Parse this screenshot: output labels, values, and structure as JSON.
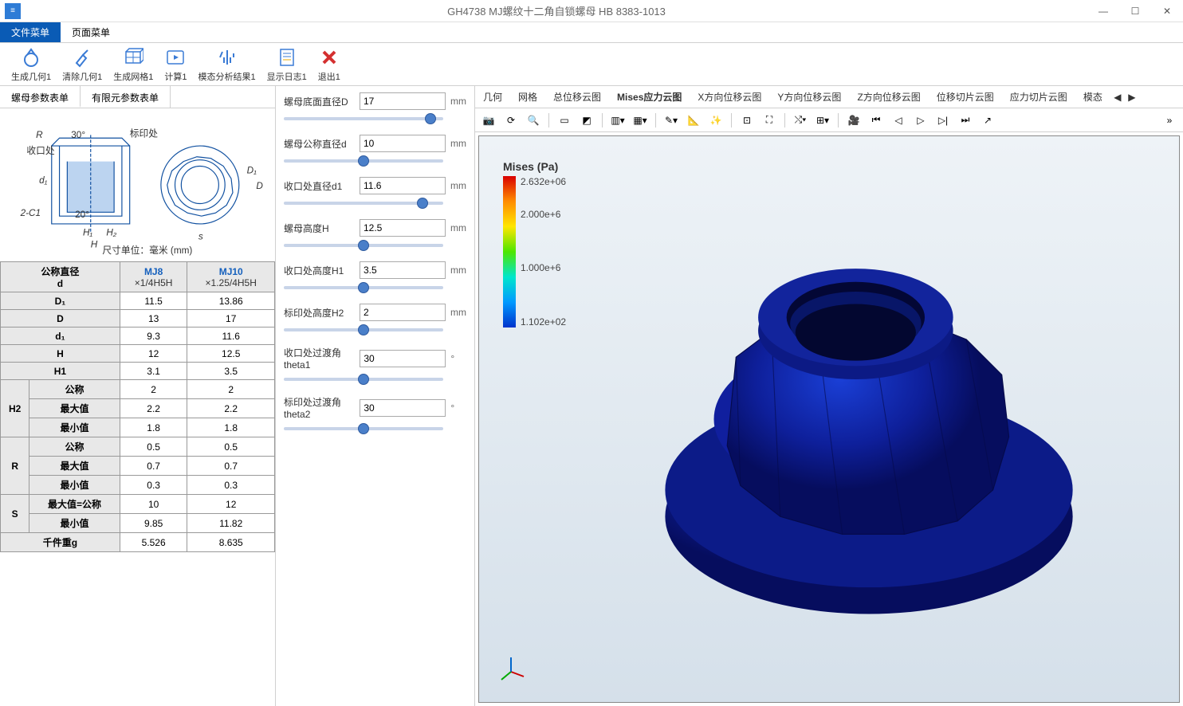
{
  "window": {
    "title": "GH4738 MJ螺纹十二角自锁螺母 HB 8383-1013"
  },
  "menubar": {
    "file": "文件菜单",
    "page": "页面菜单"
  },
  "toolbar": [
    {
      "label": "生成几何1",
      "icon": "geom"
    },
    {
      "label": "清除几何1",
      "icon": "clear"
    },
    {
      "label": "生成网格1",
      "icon": "mesh"
    },
    {
      "label": "计算1",
      "icon": "calc"
    },
    {
      "label": "模态分析结果1",
      "icon": "modal"
    },
    {
      "label": "显示日志1",
      "icon": "log"
    },
    {
      "label": "退出1",
      "icon": "exit"
    }
  ],
  "left_tabs": {
    "params": "螺母参数表单",
    "fem": "有限元参数表单"
  },
  "diagram_caption": "尺寸单位：毫米 (mm)",
  "diagram_labels": [
    "R",
    "标印处",
    "收口处",
    "d₁",
    "2-C1",
    "H₁",
    "H₂",
    "H",
    "D₁",
    "D",
    "s",
    "30°",
    "20°"
  ],
  "spec_table": {
    "header": {
      "nominal_dia_l1": "公称直径",
      "nominal_dia_l2": "d",
      "mj8_l1": "MJ8",
      "mj8_l2": "×1/4H5H",
      "mj10_l1": "MJ10",
      "mj10_l2": "×1.25/4H5H"
    },
    "rows": [
      {
        "label": "D₁",
        "mj8": "11.5",
        "mj10": "13.86"
      },
      {
        "label": "D",
        "mj8": "13",
        "mj10": "17"
      },
      {
        "label": "d₁",
        "mj8": "9.3",
        "mj10": "11.6"
      },
      {
        "label": "H",
        "mj8": "12",
        "mj10": "12.5"
      },
      {
        "label": "H1",
        "mj8": "3.1",
        "mj10": "3.5"
      }
    ],
    "h2_group": {
      "label": "H2",
      "rows": [
        {
          "sub": "公称",
          "mj8": "2",
          "mj10": "2"
        },
        {
          "sub": "最大值",
          "mj8": "2.2",
          "mj10": "2.2"
        },
        {
          "sub": "最小值",
          "mj8": "1.8",
          "mj10": "1.8"
        }
      ]
    },
    "r_group": {
      "label": "R",
      "rows": [
        {
          "sub": "公称",
          "mj8": "0.5",
          "mj10": "0.5"
        },
        {
          "sub": "最大值",
          "mj8": "0.7",
          "mj10": "0.7"
        },
        {
          "sub": "最小值",
          "mj8": "0.3",
          "mj10": "0.3"
        }
      ]
    },
    "s_group": {
      "label": "S",
      "rows": [
        {
          "sub": "最大值=公称",
          "mj8": "10",
          "mj10": "12"
        },
        {
          "sub": "最小值",
          "mj8": "9.85",
          "mj10": "11.82"
        }
      ]
    },
    "weight": {
      "label": "千件重g",
      "mj8": "5.526",
      "mj10": "8.635"
    }
  },
  "params": [
    {
      "label": "螺母底面直径D",
      "value": "17",
      "unit": "mm",
      "slider": 95
    },
    {
      "label": "螺母公称直径d",
      "value": "10",
      "unit": "mm",
      "slider": 50
    },
    {
      "label": "收口处直径d1",
      "value": "11.6",
      "unit": "mm",
      "slider": 90
    },
    {
      "label": "螺母高度H",
      "value": "12.5",
      "unit": "mm",
      "slider": 50
    },
    {
      "label": "收口处高度H1",
      "value": "3.5",
      "unit": "mm",
      "slider": 50
    },
    {
      "label": "标印处高度H2",
      "value": "2",
      "unit": "mm",
      "slider": 50
    },
    {
      "label": "收口处过渡角theta1",
      "value": "30",
      "unit": "°",
      "slider": 50
    },
    {
      "label": "标印处过渡角theta2",
      "value": "30",
      "unit": "°",
      "slider": 50
    }
  ],
  "result_tabs": [
    "几何",
    "网格",
    "总位移云图",
    "Mises应力云图",
    "X方向位移云图",
    "Y方向位移云图",
    "Z方向位移云图",
    "位移切片云图",
    "应力切片云图",
    "模态"
  ],
  "result_tab_active": 3,
  "legend": {
    "title": "Mises (Pa)",
    "ticks": [
      "2.632e+06",
      "2.000e+6",
      "",
      "1.000e+6",
      "",
      "1.102e+02"
    ]
  },
  "chart_data": {
    "type": "heatmap",
    "title": "Mises (Pa)",
    "colormap": "rainbow",
    "range_min": 110.2,
    "range_max": 2632000.0,
    "unit": "Pa",
    "ticks": [
      2632000.0,
      2000000.0,
      1000000.0,
      110.2
    ],
    "object": "12-point self-locking nut, 3D stress contour"
  }
}
